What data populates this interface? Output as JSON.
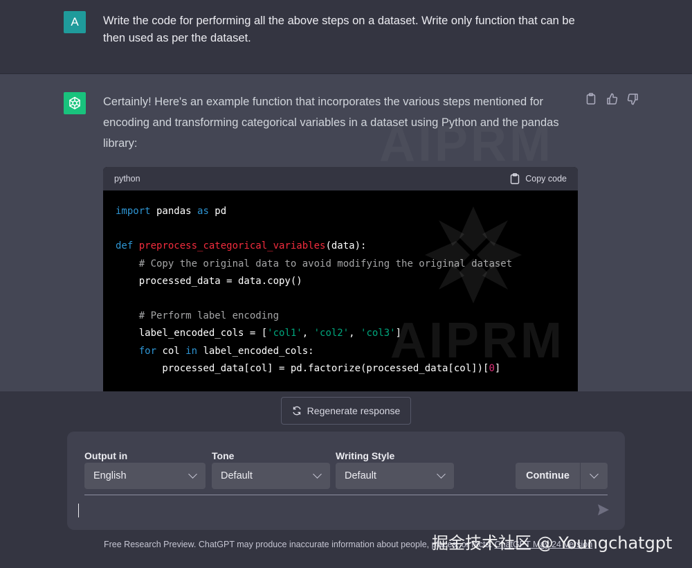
{
  "user_message": {
    "avatar_letter": "A",
    "text": "Write the code for performing all the above steps on a dataset. Write only function that can be then used as per the dataset."
  },
  "assistant_message": {
    "intro": "Certainly! Here's an example function that incorporates the various steps mentioned for encoding and transforming categorical variables in a dataset using Python and the pandas library:",
    "actions": [
      "copy-icon",
      "thumbs-up-icon",
      "thumbs-down-icon"
    ],
    "code_block": {
      "language": "python",
      "copy_label": "Copy code"
    }
  },
  "watermark": {
    "text": "AIPRM",
    "footer_overlay": "掘金技术社区 @ Youngchatgpt"
  },
  "regenerate_label": "Regenerate response",
  "prompt_panel": {
    "output_label": "Output in",
    "output_value": "English",
    "tone_label": "Tone",
    "tone_value": "Default",
    "style_label": "Writing Style",
    "style_value": "Default",
    "continue_label": "Continue",
    "input_value": ""
  },
  "footer": {
    "text": "Free Research Preview. ChatGPT may produce inaccurate information about people, places, or facts.",
    "link": "ChatGPT May 24 Version"
  },
  "colors": {
    "user_avatar": "#1f9b9b",
    "bot_avatar": "#19c37d",
    "keyword": "#2e95d3",
    "function": "#f22c3d",
    "string": "#00a67d",
    "number": "#df3079"
  }
}
